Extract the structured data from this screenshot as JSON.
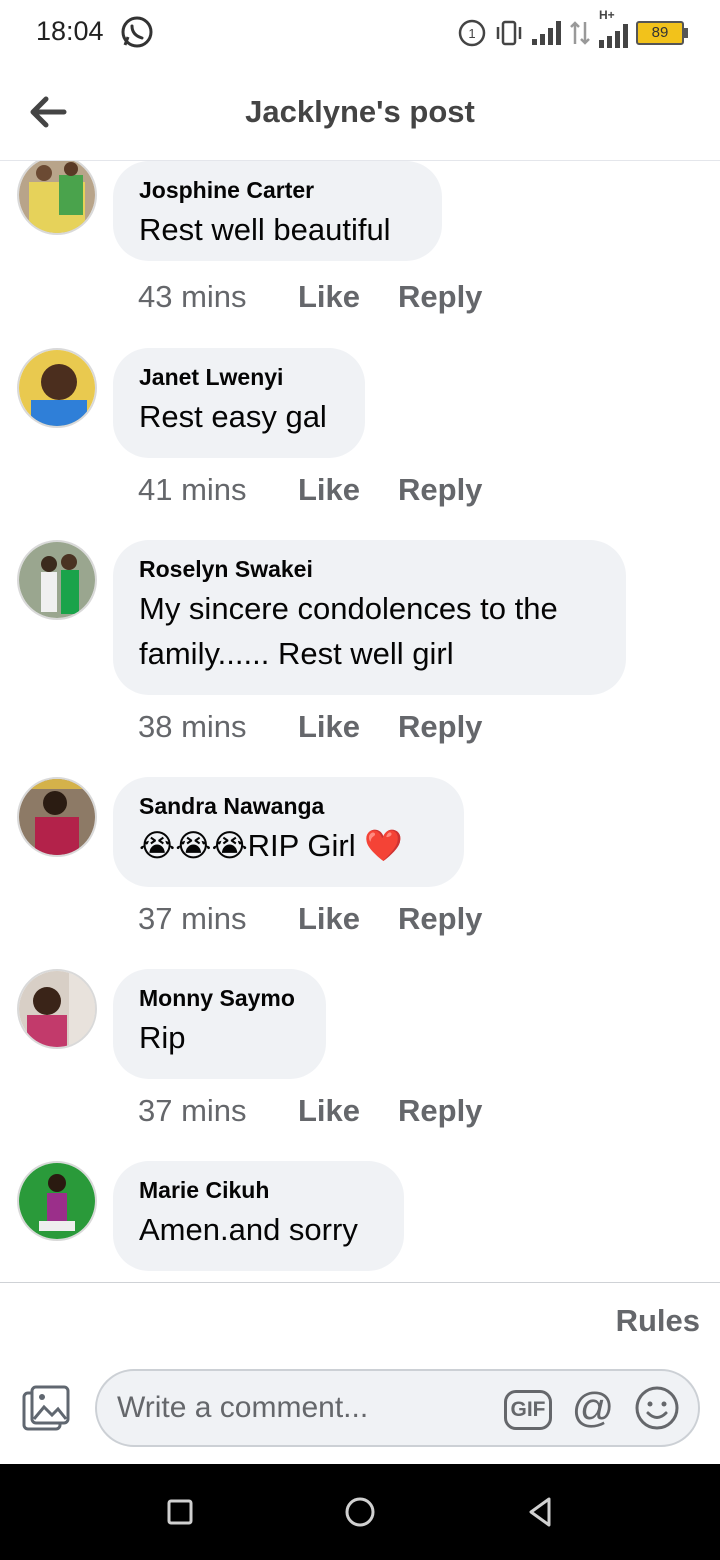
{
  "status_bar": {
    "time": "18:04",
    "battery": "89",
    "network_label": "H+"
  },
  "header": {
    "title": "Jacklyne's post"
  },
  "comments": [
    {
      "author": "Josphine Carter",
      "text": "Rest well beautiful",
      "time": "43 mins",
      "like": "Like",
      "reply": "Reply"
    },
    {
      "author": "Janet Lwenyi",
      "text": "Rest easy gal",
      "time": "41 mins",
      "like": "Like",
      "reply": "Reply"
    },
    {
      "author": "Roselyn Swakei",
      "text": "My sincere condolences to the family...... Rest well girl",
      "time": "38 mins",
      "like": "Like",
      "reply": "Reply"
    },
    {
      "author": "Sandra Nawanga",
      "text": "😭😭😭RIP Girl ❤️",
      "time": "37 mins",
      "like": "Like",
      "reply": "Reply"
    },
    {
      "author": "Monny Saymo",
      "text": "Rip",
      "time": "37 mins",
      "like": "Like",
      "reply": "Reply"
    },
    {
      "author": "Marie Cikuh",
      "text": "Amen.and sorry"
    }
  ],
  "composer": {
    "rules_label": "Rules",
    "placeholder": "Write a comment...",
    "gif_label": "GIF",
    "at_label": "@"
  },
  "colors": {
    "bubble": "#f0f2f5",
    "secondary_text": "#65676b",
    "nav_bar": "#000000"
  }
}
